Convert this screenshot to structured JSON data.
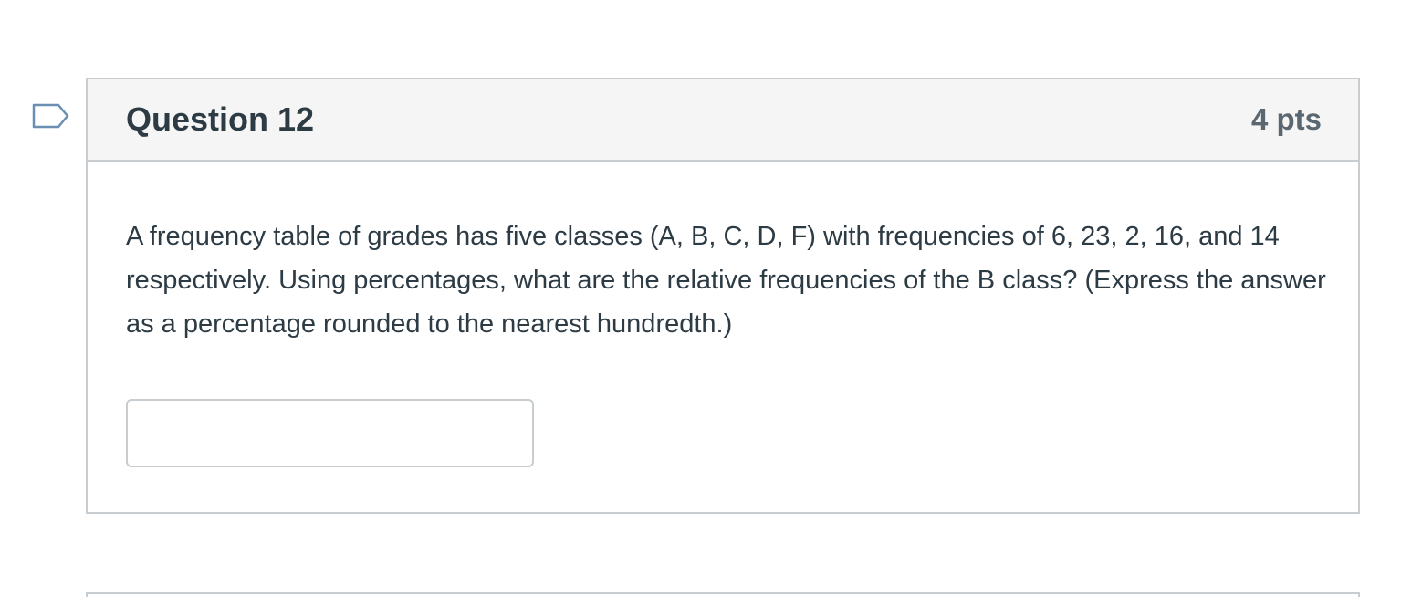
{
  "question": {
    "title": "Question 12",
    "points": "4 pts",
    "text": "A frequency table of grades has five classes (A, B, C, D, F) with frequencies of 6, 23, 2, 16, and 14 respectively. Using percentages, what are the relative frequencies of the B class? (Express the answer as a percentage rounded to the nearest hundredth.)",
    "answer_value": "",
    "flag_icon": "bookmark-flag-icon"
  },
  "colors": {
    "header_bg": "#f5f5f5",
    "border": "#c7cdd1",
    "text": "#2d3b45",
    "points_text": "#5b6770",
    "flag_stroke": "#6b8fb3"
  }
}
